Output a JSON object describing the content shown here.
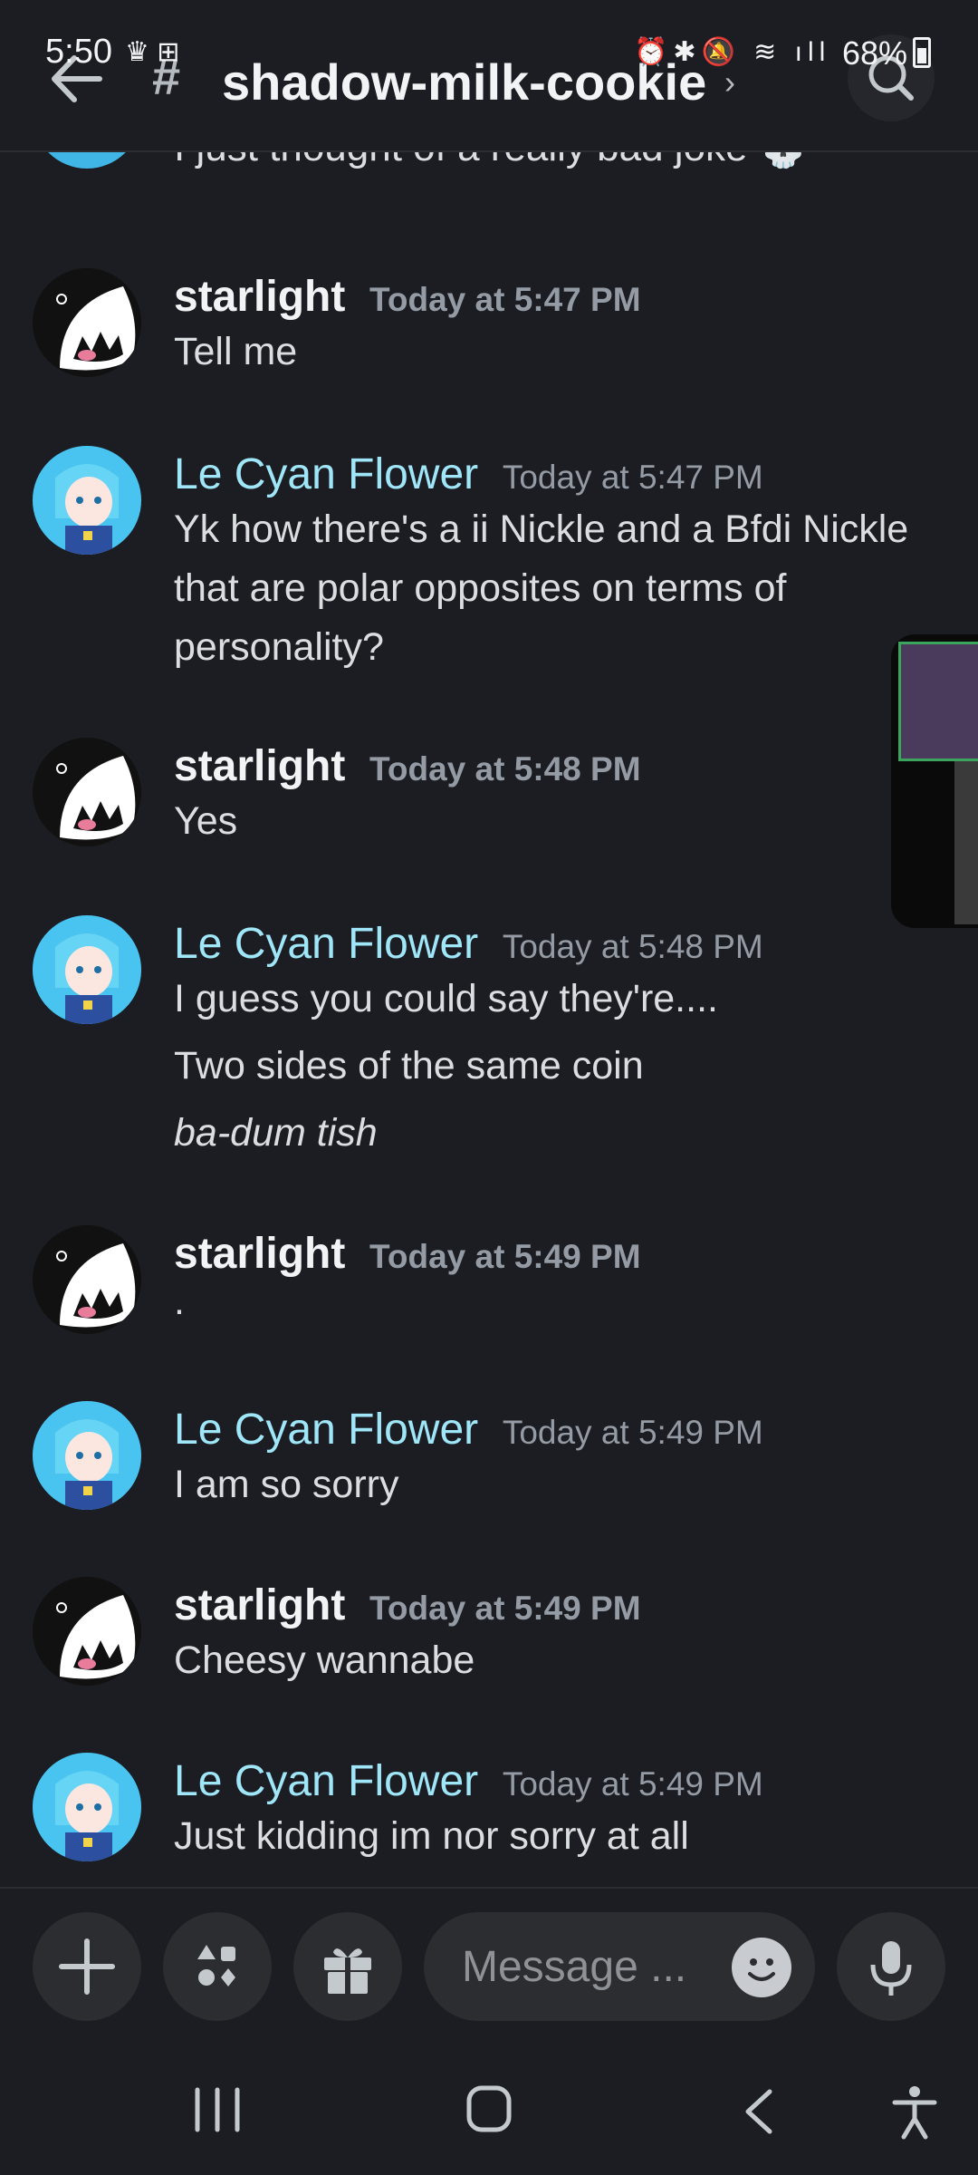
{
  "status_bar": {
    "time": "5:50",
    "battery": "68%"
  },
  "header": {
    "channel_name": "shadow-milk-cookie",
    "hash": "#"
  },
  "messages": [
    {
      "author": "",
      "author_type": "cyan",
      "timestamp": "",
      "lines": [
        {
          "text": "I just thought of a really bad joke 💀",
          "italic": false
        }
      ]
    },
    {
      "author": "starlight",
      "author_type": "star",
      "timestamp": "Today at 5:47 PM",
      "lines": [
        {
          "text": "Tell me",
          "italic": false
        }
      ]
    },
    {
      "author": "Le Cyan Flower",
      "author_type": "cyan",
      "timestamp": "Today at 5:47 PM",
      "lines": [
        {
          "text": "Yk how there's a ii Nickle and a Bfdi Nickle",
          "italic": false
        },
        {
          "text": "that are polar opposites on terms of",
          "italic": false
        },
        {
          "text": "personality?",
          "italic": false
        }
      ]
    },
    {
      "author": "starlight",
      "author_type": "star",
      "timestamp": "Today at 5:48 PM",
      "lines": [
        {
          "text": "Yes",
          "italic": false
        }
      ]
    },
    {
      "author": "Le Cyan Flower",
      "author_type": "cyan",
      "timestamp": "Today at 5:48 PM",
      "lines": [
        {
          "text": "I guess you could say they're....",
          "italic": false
        },
        {
          "text": "Two sides of the same coin",
          "italic": false
        },
        {
          "text": "ba-dum tish",
          "italic": true
        }
      ]
    },
    {
      "author": "starlight",
      "author_type": "star",
      "timestamp": "Today at 5:49 PM",
      "lines": [
        {
          "text": ".",
          "italic": false
        }
      ]
    },
    {
      "author": "Le Cyan Flower",
      "author_type": "cyan",
      "timestamp": "Today at 5:49 PM",
      "lines": [
        {
          "text": "I am so sorry",
          "italic": false
        }
      ]
    },
    {
      "author": "starlight",
      "author_type": "star",
      "timestamp": "Today at 5:49 PM",
      "lines": [
        {
          "text": "Cheesy wannabe",
          "italic": false
        }
      ]
    },
    {
      "author": "Le Cyan Flower",
      "author_type": "cyan",
      "timestamp": "Today at 5:49 PM",
      "lines": [
        {
          "text": "Just kidding im nor sorry at all",
          "italic": false
        }
      ]
    }
  ],
  "composer": {
    "placeholder": "Message ...",
    "icons": [
      "plus-icon",
      "apps-icon",
      "gift-icon",
      "emoji-icon",
      "microphone-icon"
    ]
  },
  "nav_bar": {
    "icons": [
      "recent-apps-icon",
      "home-icon",
      "back-icon",
      "accessibility-icon"
    ]
  }
}
